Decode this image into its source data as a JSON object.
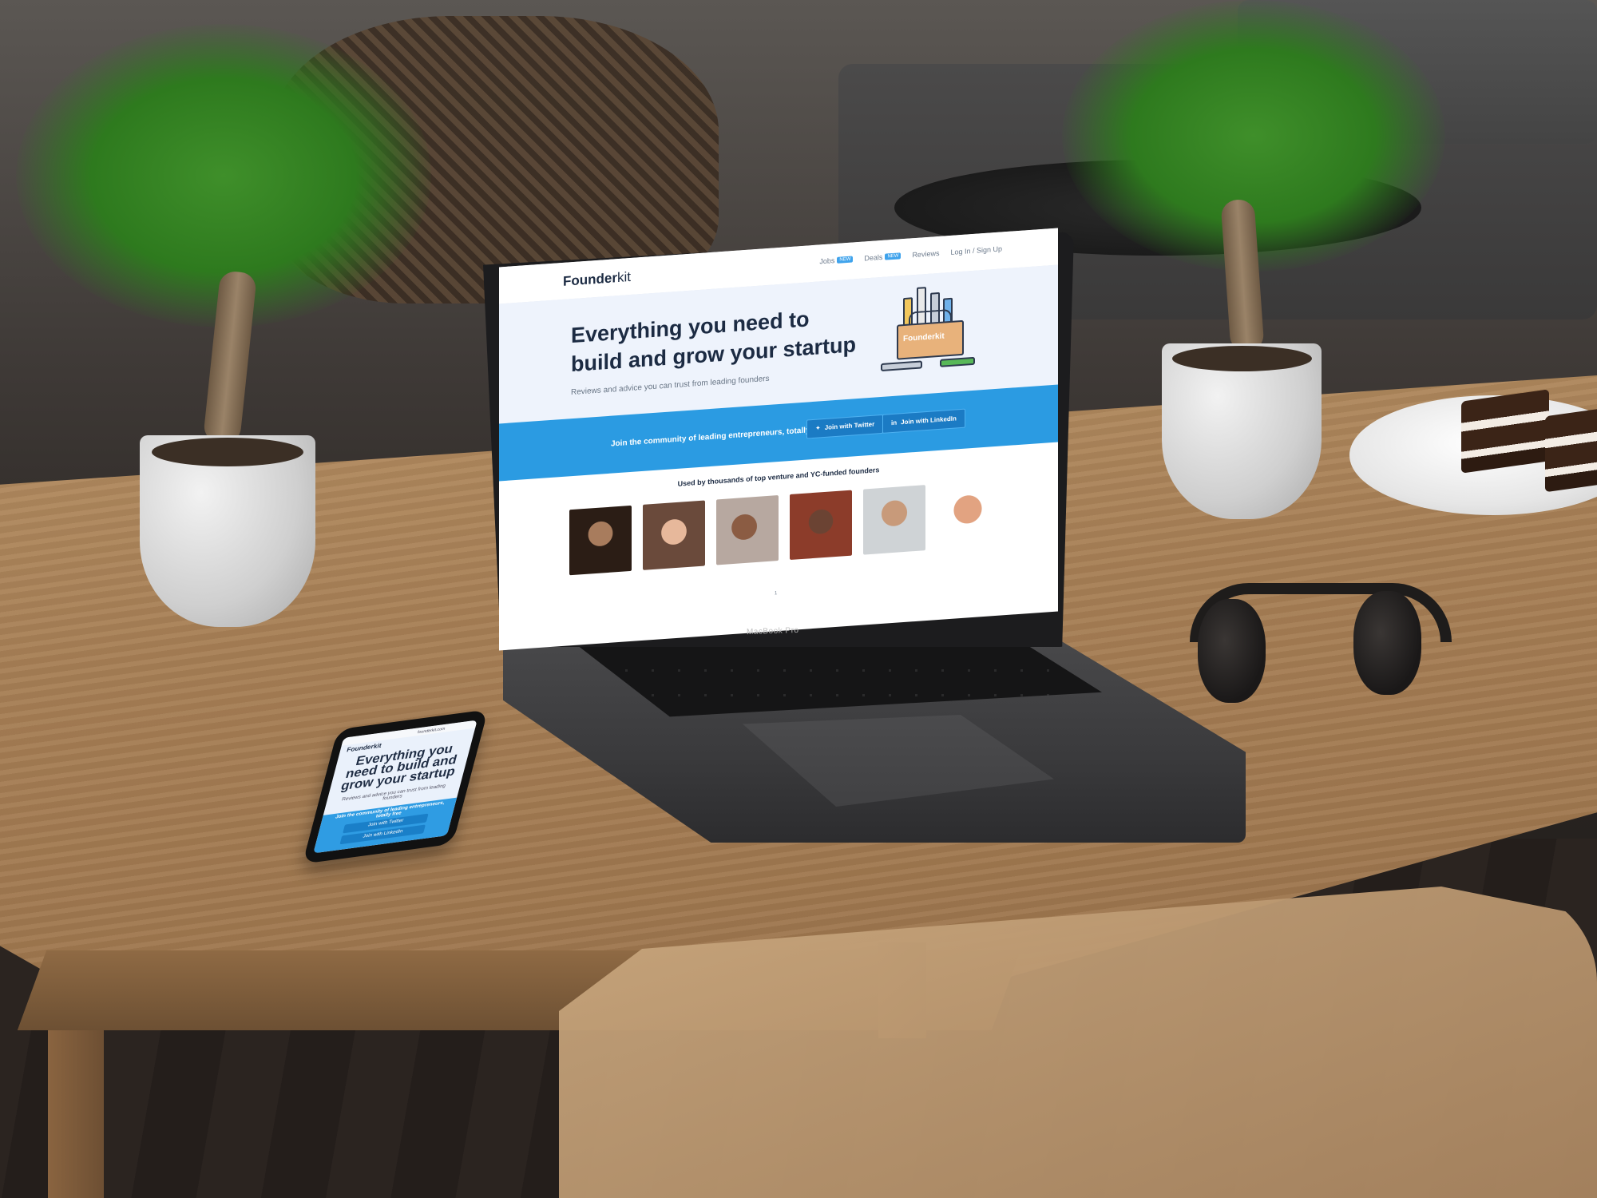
{
  "laptop": {
    "brand": "MacBook Pro",
    "website": {
      "logo": {
        "f_part": "Founder",
        "kit_part": "kit"
      },
      "nav": [
        {
          "label": "Jobs",
          "badge": "NEW"
        },
        {
          "label": "Deals",
          "badge": "NEW"
        },
        {
          "label": "Reviews",
          "badge": ""
        },
        {
          "label": "Log In / Sign Up",
          "badge": ""
        }
      ],
      "hero": {
        "title": "Everything you need to build and grow your startup",
        "subtitle": "Reviews and advice you can trust from leading founders",
        "toolbox_label": "Founderkit"
      },
      "cta": {
        "text": "Join the community of leading entrepreneurs, totally free",
        "twitter_button": "Join with Twitter",
        "linkedin_button": "Join with LinkedIn"
      },
      "used_by": "Used by thousands of top venture and YC-funded founders",
      "page_indicator": "1"
    }
  },
  "phone": {
    "logo": "Founderkit",
    "url": "founderkit.com",
    "title": "Everything you need to build and grow your startup",
    "subtitle": "Reviews and advice you can trust from leading founders",
    "cta_text": "Join the community of leading entrepreneurs, totally free",
    "twitter_button": "Join with Twitter",
    "linkedin_button": "Join with LinkedIn"
  },
  "colors": {
    "brand_blue": "#2b9be2",
    "navy_text": "#1c2b43",
    "hero_bg": "#eef3fc"
  }
}
